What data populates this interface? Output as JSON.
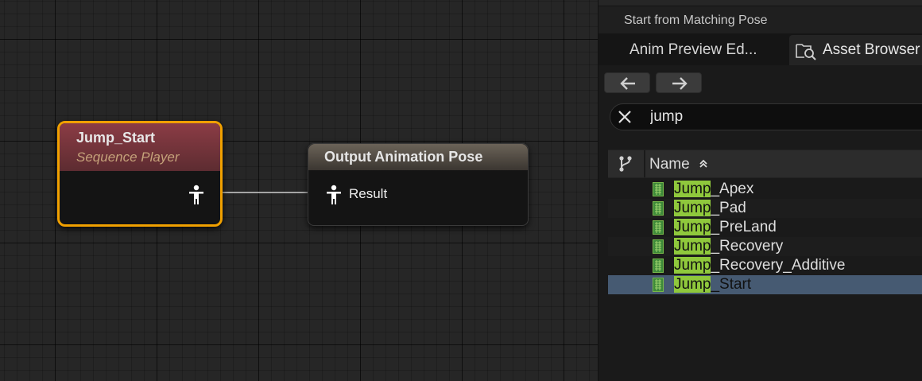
{
  "graph": {
    "node_start": {
      "title": "Jump_Start",
      "subtitle": "Sequence Player"
    },
    "node_output": {
      "title": "Output Animation Pose",
      "pin_label": "Result"
    }
  },
  "panel": {
    "top_label": "Start from Matching Pose",
    "tabs": [
      {
        "label": "Anim Preview Ed..."
      },
      {
        "label": "Asset Browser"
      }
    ],
    "search": {
      "value": "jump"
    },
    "table": {
      "column_name": "Name",
      "highlight_prefix": "Jump",
      "rows": [
        {
          "rest": "_Apex"
        },
        {
          "rest": "_Pad"
        },
        {
          "rest": "_PreLand"
        },
        {
          "rest": "_Recovery"
        },
        {
          "rest": "_Recovery_Additive"
        },
        {
          "rest": "_Start",
          "selected": true
        }
      ]
    }
  },
  "colors": {
    "selection_outline": "#f0a000",
    "search_highlight": "#8fc83c",
    "selected_row": "#465a72"
  }
}
